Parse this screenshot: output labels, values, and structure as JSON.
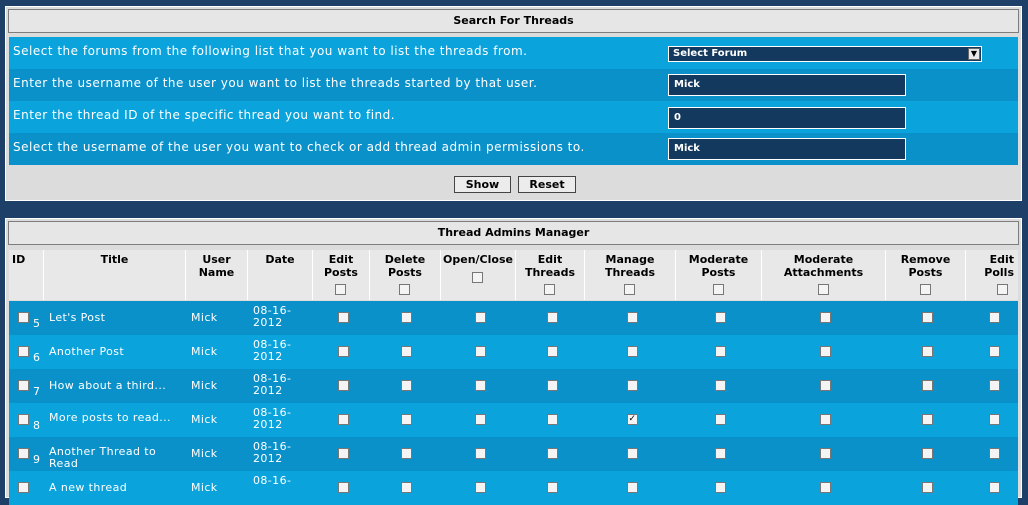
{
  "search": {
    "title": "Search For Threads",
    "rows": [
      {
        "label": "Select the forums from the following list that you want to list the threads from.",
        "value": "Select Forum"
      },
      {
        "label": "Enter the username of the user you want to list the threads started by that user.",
        "value": "Mick"
      },
      {
        "label": "Enter the thread ID of the specific thread you want to find.",
        "value": "0"
      },
      {
        "label": "Select the username of the user you want to check or add thread admin permissions to.",
        "value": "Mick"
      }
    ],
    "show_label": "Show",
    "reset_label": "Reset"
  },
  "manager": {
    "title": "Thread Admins Manager",
    "columns": [
      "ID",
      "Title",
      "User Name",
      "Date",
      "Edit Posts",
      "Delete Posts",
      "Open/Close",
      "Edit Threads",
      "Manage Threads",
      "Moderate Posts",
      "Moderate Attachments",
      "Remove Posts",
      "Edit Polls"
    ],
    "rows": [
      {
        "id": "5",
        "title": "Let's Post",
        "user": "Mick",
        "date": "08-16-2012",
        "perms": [
          false,
          false,
          false,
          false,
          false,
          false,
          false,
          false,
          false
        ]
      },
      {
        "id": "6",
        "title": "Another Post",
        "user": "Mick",
        "date": "08-16-2012",
        "perms": [
          false,
          false,
          false,
          false,
          false,
          false,
          false,
          false,
          false
        ]
      },
      {
        "id": "7",
        "title": "How about a third...",
        "user": "Mick",
        "date": "08-16-2012",
        "perms": [
          false,
          false,
          false,
          false,
          false,
          false,
          false,
          false,
          false
        ]
      },
      {
        "id": "8",
        "title": "More posts to read...",
        "user": "Mick",
        "date": "08-16-2012",
        "perms": [
          false,
          false,
          false,
          false,
          true,
          false,
          false,
          false,
          false
        ]
      },
      {
        "id": "9",
        "title": "Another Thread to Read",
        "user": "Mick",
        "date": "08-16-2012",
        "perms": [
          false,
          false,
          false,
          false,
          false,
          false,
          false,
          false,
          false
        ]
      },
      {
        "id": "",
        "title": "A new thread",
        "user": "Mick",
        "date": "08-16-",
        "perms": [
          false,
          false,
          false,
          false,
          false,
          false,
          false,
          false,
          false
        ]
      }
    ]
  }
}
